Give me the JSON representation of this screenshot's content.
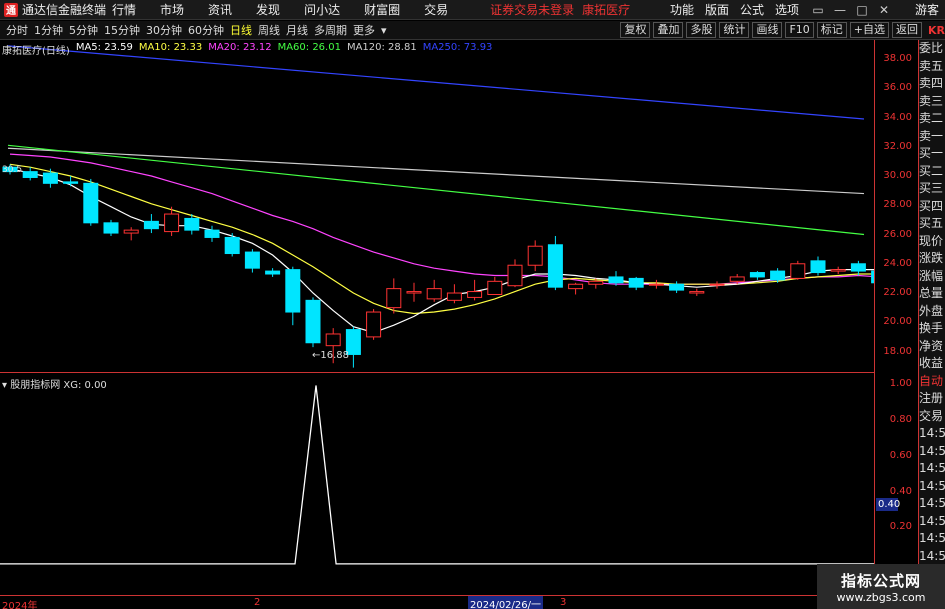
{
  "app": {
    "title": "通达信金融终端",
    "logo_char": "通"
  },
  "menu": [
    "行情",
    "市场",
    "资讯",
    "发现",
    "问小达",
    "财富圈",
    "交易"
  ],
  "warning": "证券交易未登录",
  "stock_title": "康拓医疗",
  "right_menu": [
    "功能",
    "版面",
    "公式",
    "选项"
  ],
  "guest": "游客",
  "period_tabs": [
    "分时",
    "1分钟",
    "5分钟",
    "15分钟",
    "30分钟",
    "60分钟",
    "日线",
    "周线",
    "月线",
    "多周期",
    "更多"
  ],
  "active_period": "日线",
  "tool_buttons": [
    "复权",
    "叠加",
    "多股",
    "统计",
    "画线",
    "F10",
    "标记",
    "+自选",
    "返回"
  ],
  "kr_label": "KR",
  "legend": {
    "name": "康拓医疗(日线)",
    "items": [
      {
        "label": "MA5: 23.59",
        "color": "#ffffff"
      },
      {
        "label": "MA10: 23.33",
        "color": "#ffff44"
      },
      {
        "label": "MA20: 23.12",
        "color": "#ff44ff"
      },
      {
        "label": "MA60: 26.01",
        "color": "#44ff44"
      },
      {
        "label": "MA120: 28.81",
        "color": "#cccccc"
      },
      {
        "label": "MA250: 73.93",
        "color": "#3344ff"
      }
    ]
  },
  "low_label": "←16.88",
  "left_price_label": "30.5",
  "right_panel": [
    "委比",
    "卖五",
    "卖四",
    "卖三",
    "卖二",
    "卖一",
    "买一",
    "买二",
    "买三",
    "买四",
    "买五",
    "现价",
    "涨跌",
    "涨幅",
    "总量",
    "外盘",
    "换手",
    "净资",
    "收益",
    "自动",
    "注册",
    "交易",
    "14:56",
    "14:56",
    "14:56",
    "14:56",
    "14:56",
    "14:56",
    "14:56",
    "14:56",
    "14:56"
  ],
  "ind_legend": "股朋指标网 XG: 0.00",
  "ind_value": "0.40",
  "dates": {
    "d1": "2024年",
    "d2": "2",
    "d3": "2024/02/26/一",
    "d4": "3"
  },
  "watermark": {
    "line1": "指标公式网",
    "line2": "www.zbgs3.com"
  },
  "colors": {
    "up": "#ff3333",
    "down": "#00e5ff",
    "axis": "#e33333"
  },
  "chart_data": {
    "type": "candlestick",
    "y_axis_labels": [
      "38.00",
      "36.00",
      "34.00",
      "32.00",
      "30.00",
      "28.00",
      "26.00",
      "24.00",
      "22.00",
      "20.00",
      "18.00"
    ],
    "ylim": [
      16.6,
      39.3
    ],
    "candles": [
      {
        "o": 30.6,
        "h": 30.8,
        "c": 30.3,
        "l": 30.1
      },
      {
        "o": 30.3,
        "h": 30.6,
        "c": 29.9,
        "l": 29.7
      },
      {
        "o": 30.2,
        "h": 30.5,
        "c": 29.5,
        "l": 29.2
      },
      {
        "o": 29.6,
        "h": 30.0,
        "c": 29.5,
        "l": 29.3
      },
      {
        "o": 29.5,
        "h": 29.8,
        "c": 26.8,
        "l": 26.6
      },
      {
        "o": 26.8,
        "h": 27.0,
        "c": 26.1,
        "l": 25.9
      },
      {
        "o": 26.1,
        "h": 26.5,
        "c": 26.3,
        "l": 25.6
      },
      {
        "o": 26.9,
        "h": 27.4,
        "c": 26.4,
        "l": 26.1
      },
      {
        "o": 26.2,
        "h": 27.9,
        "c": 27.4,
        "l": 25.9
      },
      {
        "o": 27.1,
        "h": 27.4,
        "c": 26.3,
        "l": 26.0
      },
      {
        "o": 26.3,
        "h": 26.6,
        "c": 25.8,
        "l": 25.5
      },
      {
        "o": 25.8,
        "h": 26.1,
        "c": 24.7,
        "l": 24.5
      },
      {
        "o": 24.8,
        "h": 25.0,
        "c": 23.7,
        "l": 23.4
      },
      {
        "o": 23.5,
        "h": 23.7,
        "c": 23.3,
        "l": 23.1
      },
      {
        "o": 23.6,
        "h": 23.8,
        "c": 20.7,
        "l": 19.8
      },
      {
        "o": 21.5,
        "h": 21.7,
        "c": 18.6,
        "l": 18.3
      },
      {
        "o": 18.4,
        "h": 19.6,
        "c": 19.2,
        "l": 17.2
      },
      {
        "o": 19.5,
        "h": 19.7,
        "c": 17.8,
        "l": 16.9
      },
      {
        "o": 19.0,
        "h": 20.9,
        "c": 20.7,
        "l": 18.8
      },
      {
        "o": 21.0,
        "h": 23.0,
        "c": 22.3,
        "l": 20.6
      },
      {
        "o": 22.0,
        "h": 22.7,
        "c": 22.1,
        "l": 21.4
      },
      {
        "o": 21.6,
        "h": 22.9,
        "c": 22.3,
        "l": 21.4
      },
      {
        "o": 21.5,
        "h": 22.6,
        "c": 22.0,
        "l": 21.3
      },
      {
        "o": 21.7,
        "h": 22.9,
        "c": 22.1,
        "l": 21.5
      },
      {
        "o": 21.9,
        "h": 23.1,
        "c": 22.8,
        "l": 21.9
      },
      {
        "o": 22.5,
        "h": 24.3,
        "c": 23.9,
        "l": 22.4
      },
      {
        "o": 23.9,
        "h": 25.6,
        "c": 25.2,
        "l": 23.5
      },
      {
        "o": 25.3,
        "h": 25.9,
        "c": 22.4,
        "l": 22.2
      },
      {
        "o": 22.3,
        "h": 22.7,
        "c": 22.6,
        "l": 21.9
      },
      {
        "o": 22.6,
        "h": 23.0,
        "c": 22.8,
        "l": 22.3
      },
      {
        "o": 23.1,
        "h": 23.5,
        "c": 22.7,
        "l": 22.5
      },
      {
        "o": 23.0,
        "h": 23.1,
        "c": 22.4,
        "l": 22.2
      },
      {
        "o": 22.6,
        "h": 22.9,
        "c": 22.6,
        "l": 22.3
      },
      {
        "o": 22.6,
        "h": 22.8,
        "c": 22.2,
        "l": 22.0
      },
      {
        "o": 22.0,
        "h": 22.3,
        "c": 22.1,
        "l": 21.8
      },
      {
        "o": 22.6,
        "h": 22.8,
        "c": 22.6,
        "l": 22.3
      },
      {
        "o": 22.8,
        "h": 23.3,
        "c": 23.1,
        "l": 22.6
      },
      {
        "o": 23.4,
        "h": 23.5,
        "c": 23.1,
        "l": 22.9
      },
      {
        "o": 23.5,
        "h": 23.7,
        "c": 22.9,
        "l": 22.7
      },
      {
        "o": 23.0,
        "h": 24.2,
        "c": 24.0,
        "l": 22.9
      },
      {
        "o": 24.2,
        "h": 24.5,
        "c": 23.4,
        "l": 23.2
      },
      {
        "o": 23.5,
        "h": 23.8,
        "c": 23.6,
        "l": 23.3
      },
      {
        "o": 24.0,
        "h": 24.2,
        "c": 23.5,
        "l": 23.2
      },
      {
        "o": 23.5,
        "h": 23.8,
        "c": 22.7,
        "l": 22.5
      }
    ],
    "ma": [
      {
        "name": "MA250",
        "color": "#3344ff",
        "start": 38.9,
        "end": 33.9
      },
      {
        "name": "MA120",
        "color": "#cccccc",
        "start": 31.9,
        "end": 28.8
      },
      {
        "name": "MA60",
        "color": "#44ff44",
        "start": 32.1,
        "end": 26.0
      }
    ],
    "ma20": [
      31.5,
      31.4,
      31.3,
      31.1,
      30.9,
      30.6,
      30.3,
      30.0,
      29.6,
      29.2,
      28.8,
      28.3,
      27.8,
      27.3,
      26.9,
      26.4,
      25.8,
      25.3,
      24.8,
      24.4,
      24.0,
      23.7,
      23.5,
      23.3,
      23.2,
      23.2,
      23.2,
      23.1,
      22.9,
      22.7,
      22.6,
      22.6,
      22.6,
      22.6,
      22.6,
      22.6,
      22.7,
      22.8,
      22.9,
      23.0,
      23.1,
      23.1,
      23.2,
      23.1
    ],
    "ma10": [
      30.8,
      30.6,
      30.3,
      30.0,
      29.6,
      29.1,
      28.6,
      28.1,
      27.7,
      27.3,
      26.9,
      26.5,
      26.0,
      25.4,
      24.6,
      23.8,
      22.9,
      22.0,
      21.3,
      20.8,
      20.6,
      20.7,
      20.9,
      21.2,
      21.6,
      22.1,
      22.6,
      22.9,
      23.0,
      22.9,
      22.8,
      22.7,
      22.7,
      22.6,
      22.6,
      22.6,
      22.6,
      22.7,
      22.8,
      23.0,
      23.1,
      23.2,
      23.3,
      23.3
    ],
    "ma5": [
      30.5,
      30.2,
      29.9,
      29.4,
      28.6,
      27.9,
      27.2,
      26.7,
      26.6,
      26.6,
      26.3,
      25.9,
      25.4,
      24.6,
      23.4,
      22.0,
      20.8,
      19.7,
      19.3,
      19.8,
      20.4,
      21.2,
      21.9,
      22.1,
      22.4,
      22.9,
      23.3,
      23.3,
      23.2,
      23.0,
      22.9,
      22.7,
      22.6,
      22.5,
      22.4,
      22.5,
      22.6,
      22.8,
      23.0,
      23.2,
      23.5,
      23.6,
      23.6,
      23.6
    ],
    "indicator": {
      "name": "XG",
      "y_axis_labels": [
        "1.00",
        "0.80",
        "0.60",
        "0.40",
        "0.20"
      ],
      "ylim": [
        -0.18,
        1.07
      ],
      "points": [
        {
          "x": 0,
          "y": 0
        },
        {
          "x": 0.3375,
          "y": 0
        },
        {
          "x": 0.3616,
          "y": 1
        },
        {
          "x": 0.3845,
          "y": 0
        },
        {
          "x": 1,
          "y": 0
        }
      ]
    }
  }
}
